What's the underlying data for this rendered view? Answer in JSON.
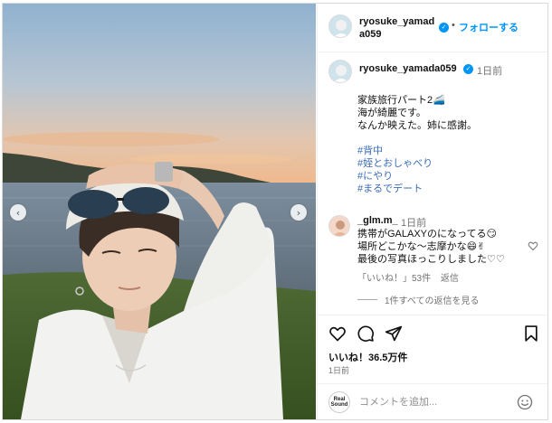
{
  "post": {
    "username": "ryosuke_yamada059",
    "header_username": "ryosuke_yamad a059",
    "follow_label": "フォローする",
    "dot": "•",
    "verified_mark": "✓",
    "caption_time": "1日前",
    "caption_lines": [
      "家族旅行パート2🚄",
      "海が綺麗です。",
      "なんか映えた。姉に感謝。"
    ],
    "hashtags": [
      "#背中",
      "#姪とおしゃべり",
      "#にやり",
      "#まるでデート"
    ]
  },
  "comment": {
    "username": "_glm.m_",
    "time": "1日前",
    "lines": [
      "携帯がGALAXYのになってる😏",
      "場所どこかな〜志摩かな😄✌",
      "最後の写真ほっこりしました♡♡"
    ],
    "likes_label": "「いいね！」53件",
    "reply_label": "返信",
    "view_replies": "1件すべての返信を見る"
  },
  "actions": {
    "likes": "いいね！36.5万件",
    "date": "1日前"
  },
  "comment_bar": {
    "logo_line1": "Real",
    "logo_line2": "Sound",
    "placeholder": "コメントを追加..."
  },
  "carousel": {
    "prev": "‹",
    "next": "›"
  },
  "colors": {
    "accent": "#0095f6",
    "hashtag": "#3a6cb5",
    "muted": "#737373"
  },
  "icons": [
    "heart-icon",
    "comment-icon",
    "share-icon",
    "bookmark-icon",
    "emoji-icon",
    "verified-badge-icon"
  ]
}
